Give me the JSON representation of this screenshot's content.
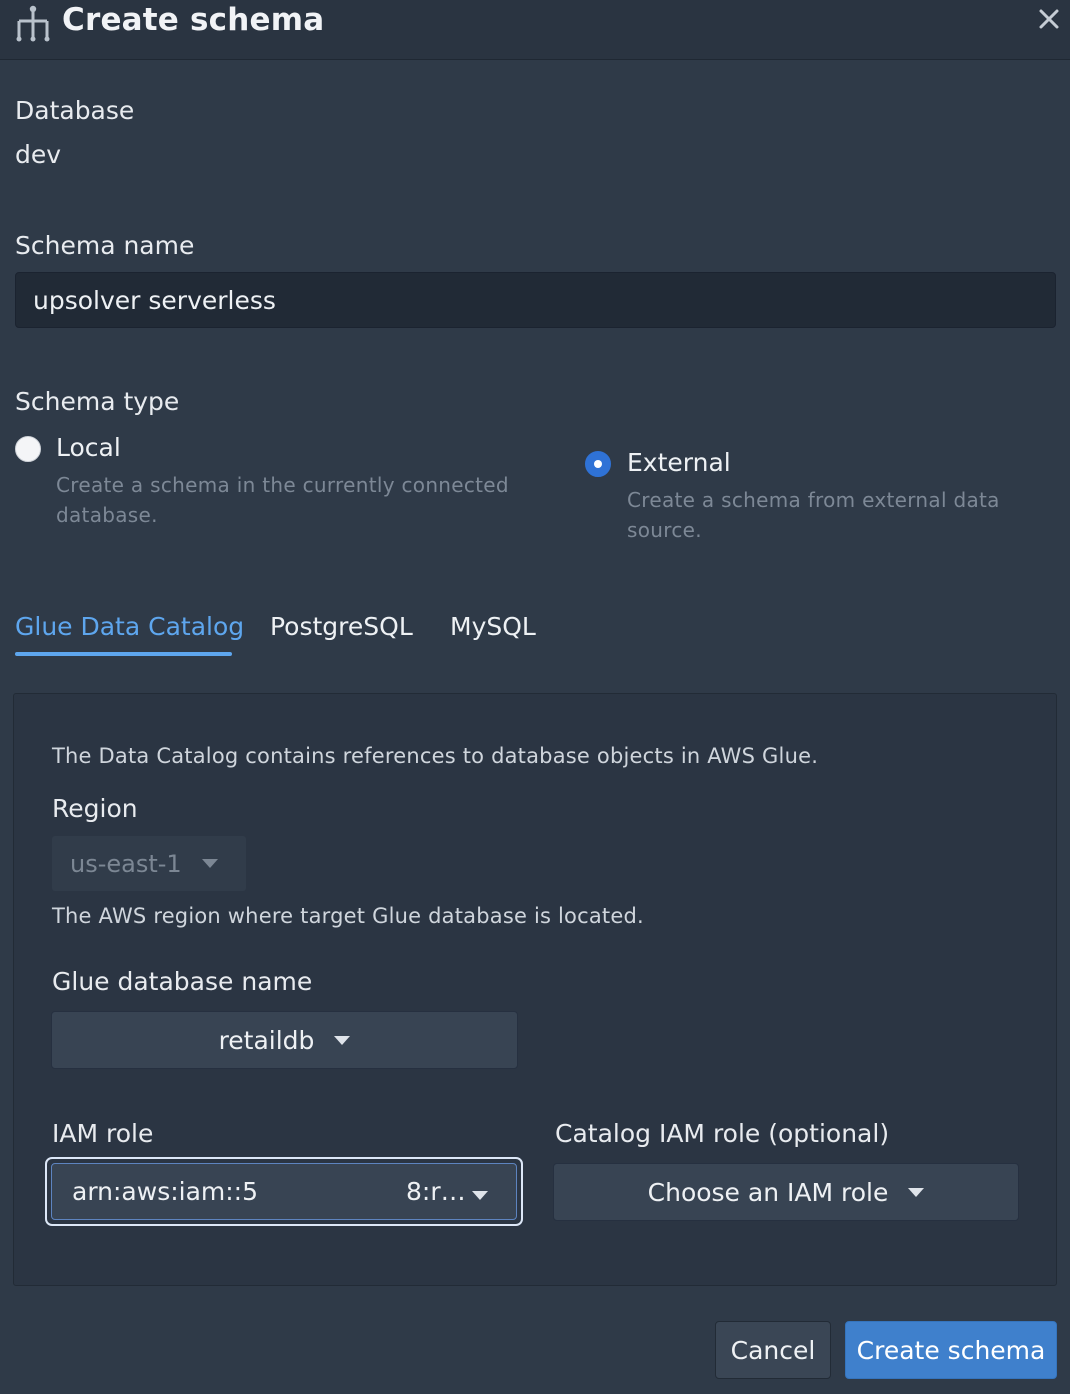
{
  "header": {
    "title": "Create schema",
    "icon": "schema-tree-icon",
    "close_icon": "close-icon"
  },
  "database": {
    "label": "Database",
    "value": "dev"
  },
  "schema_name": {
    "label": "Schema name",
    "value": "upsolver serverless"
  },
  "schema_type": {
    "label": "Schema type",
    "options": [
      {
        "title": "Local",
        "description": "Create a schema in the currently connected database.",
        "selected": false
      },
      {
        "title": "External",
        "description": "Create a schema from external data source.",
        "selected": true
      }
    ]
  },
  "tabs": [
    {
      "label": "Glue Data Catalog",
      "active": true
    },
    {
      "label": "PostgreSQL",
      "active": false
    },
    {
      "label": "MySQL",
      "active": false
    }
  ],
  "glue": {
    "description": "The Data Catalog contains references to database objects in AWS Glue.",
    "region": {
      "label": "Region",
      "value": "us-east-1",
      "help": "The AWS region where target Glue database is located."
    },
    "glue_db": {
      "label": "Glue database name",
      "value": "retaildb"
    },
    "iam_role": {
      "label": "IAM role",
      "value_prefix": "arn:aws:iam::5",
      "value_suffix": "8:r…"
    },
    "catalog_iam_role": {
      "label": "Catalog IAM role (optional)",
      "placeholder": "Choose an IAM role"
    }
  },
  "footer": {
    "cancel_label": "Cancel",
    "create_label": "Create schema"
  },
  "colors": {
    "accent": "#5ea6ee",
    "primary_button": "#3f80cc",
    "background": "#2f3a48"
  }
}
